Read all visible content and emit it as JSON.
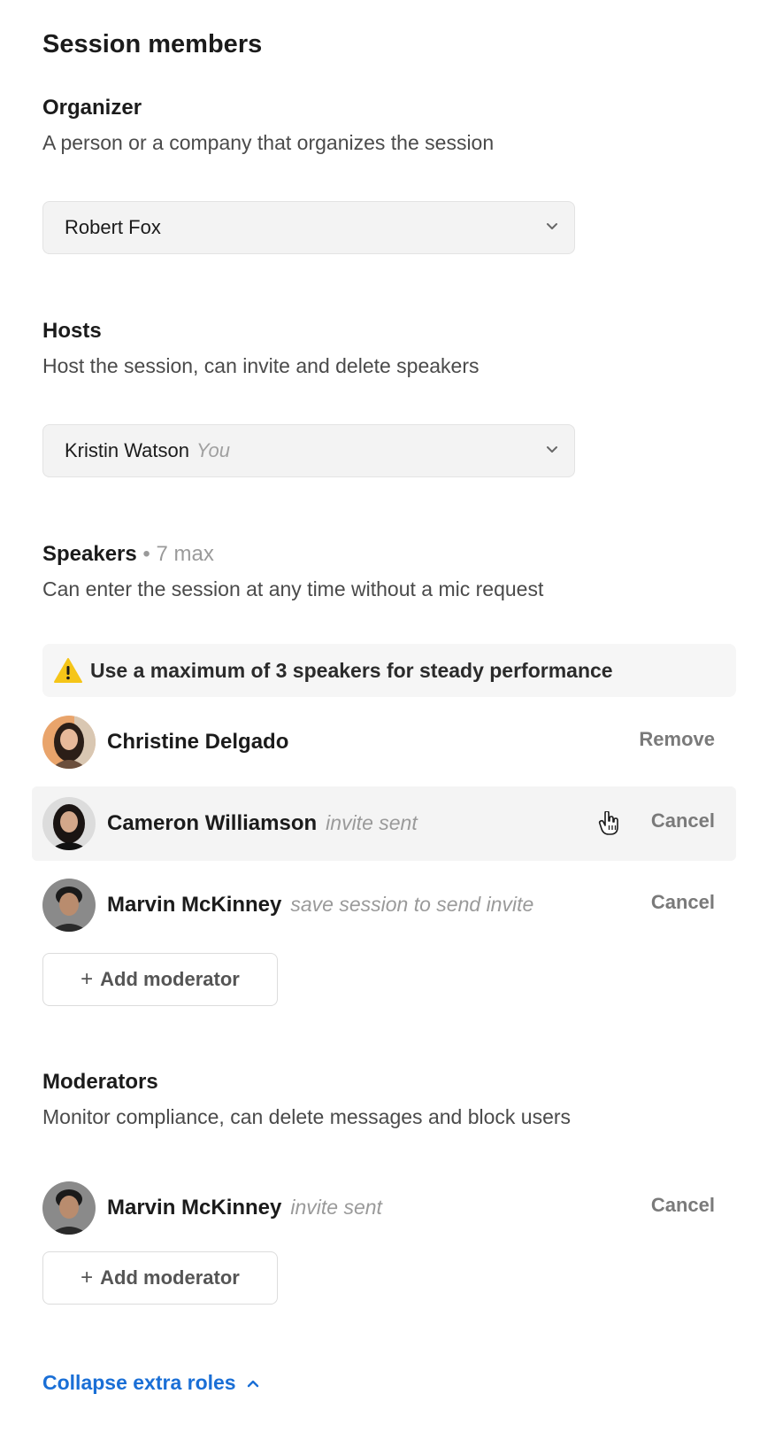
{
  "page": {
    "title": "Session members"
  },
  "organizer": {
    "title": "Organizer",
    "description": "A person or a company that organizes the session",
    "selected": "Robert Fox"
  },
  "hosts": {
    "title": "Hosts",
    "description": "Host the session, can invite and delete speakers",
    "selected": "Kristin Watson",
    "selected_hint": "You"
  },
  "speakers": {
    "title": "Speakers",
    "limit": "• 7 max",
    "description": "Can enter the session at any time without a mic request",
    "warning": "Use a maximum of 3 speakers for steady performance",
    "members": [
      {
        "name": "Christine Delgado",
        "status": "",
        "action": "Remove"
      },
      {
        "name": "Cameron Williamson",
        "status": "invite sent",
        "action": "Cancel"
      },
      {
        "name": "Marvin McKinney",
        "status": "save session to send invite",
        "action": "Cancel"
      }
    ],
    "add_label": "Add moderator"
  },
  "moderators": {
    "title": "Moderators",
    "description": "Monitor compliance, can delete messages and block users",
    "members": [
      {
        "name": "Marvin McKinney",
        "status": "invite sent",
        "action": "Cancel"
      }
    ],
    "add_label": "Add moderator"
  },
  "footer": {
    "collapse_label": "Collapse extra roles"
  },
  "icons": {
    "plus": "+",
    "warning": "warning-triangle-icon",
    "select_chevron": "chevron-down-icon",
    "collapse_chevron": "chevron-up-icon",
    "cursor": "hand-pointer-icon"
  },
  "colors": {
    "accent": "#1a6fd6",
    "warning": "#f5c518",
    "muted": "#9a9a9a"
  }
}
